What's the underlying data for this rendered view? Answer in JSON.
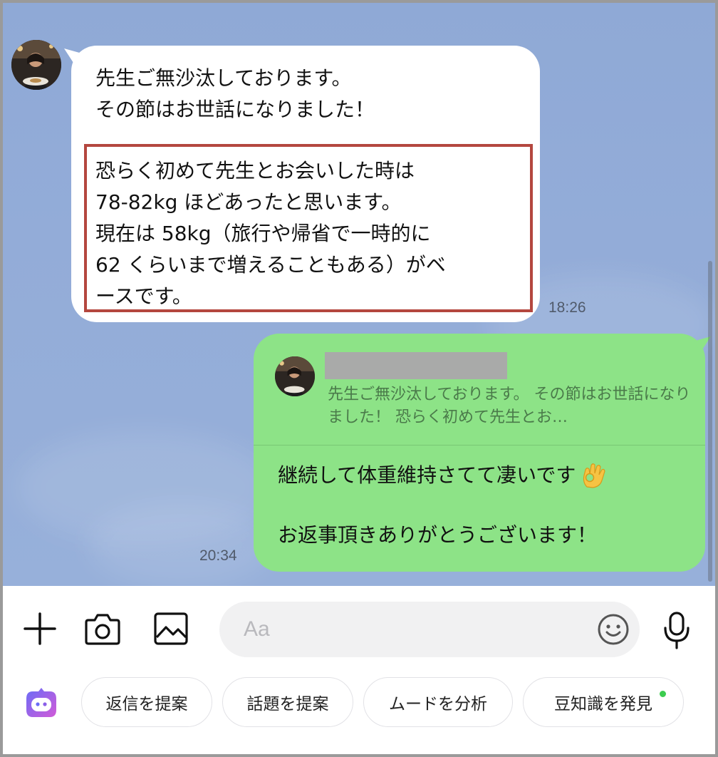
{
  "incoming": {
    "intro_lines": "先生ご無沙汰しております。\nその節はお世話になりました！",
    "highlighted_lines": "恐らく初めて先生とお会いした時は\n78-82kg ほどあったと思います。\n現在は 58kg（旅行や帰省で一時的に\n62 くらいまで増えることもある）がベ\nースです。",
    "time": "18:26"
  },
  "outgoing": {
    "quote_text": "先生ご無沙汰しております。 その節はお世話になりました！ 恐らく初めて先生とお…",
    "line1": "継続して体重維持さてて凄いです",
    "line2": "お返事頂きありがとうございます！",
    "emoji": "ok-hand",
    "time": "20:34"
  },
  "input": {
    "placeholder": "Aa",
    "value": ""
  },
  "suggestions": [
    {
      "label": "返信を提案"
    },
    {
      "label": "話題を提案"
    },
    {
      "label": "ムードを分析"
    },
    {
      "label": "豆知識を発見",
      "has_new_dot": true
    }
  ],
  "colors": {
    "chat_background": "#93acd8",
    "outgoing_bubble": "#8de387",
    "incoming_bubble": "#ffffff",
    "highlight_border": "#b4473f",
    "new_dot": "#3ccc4f"
  },
  "icons": [
    "plus-icon",
    "camera-icon",
    "image-icon",
    "emoji-icon",
    "microphone-icon",
    "ai-assistant-icon"
  ]
}
